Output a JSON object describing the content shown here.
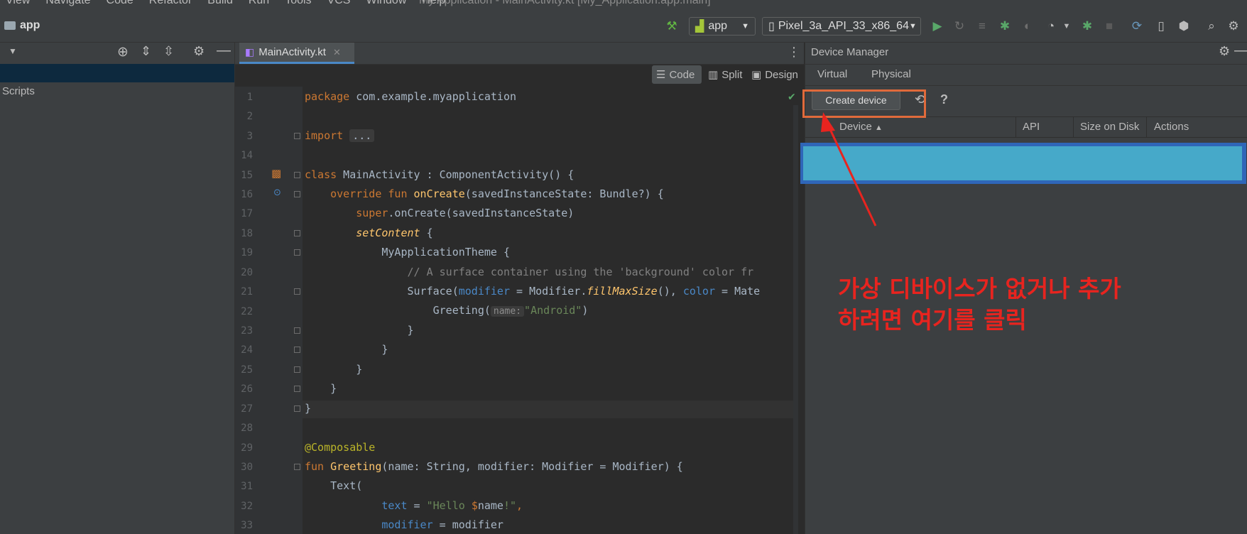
{
  "menubar": {
    "items": [
      "View",
      "Navigate",
      "Code",
      "Refactor",
      "Build",
      "Run",
      "Tools",
      "VCS",
      "Window",
      "Help"
    ],
    "window_title": "My Application - MainActivity.kt [My_Application.app.main]"
  },
  "toolbar": {
    "project": "app",
    "run_config": "app",
    "device": "Pixel_3a_API_33_x86_64"
  },
  "left_panel": {
    "item": "Scripts"
  },
  "editor": {
    "tab_label": "MainActivity.kt",
    "view_modes": [
      "Code",
      "Split",
      "Design"
    ],
    "param_hint": "name:",
    "line_numbers": [
      "1",
      "2",
      "3",
      "14",
      "15",
      "16",
      "17",
      "18",
      "19",
      "20",
      "21",
      "22",
      "23",
      "24",
      "25",
      "26",
      "27",
      "28",
      "29",
      "30",
      "31",
      "32",
      "33"
    ],
    "code": {
      "l1_kw": "package",
      "l1_rest": " com.example.myapplication",
      "l3_kw": "import",
      "l3_rest": "...",
      "l15_kw": "class",
      "l15_rest": " MainActivity : ComponentActivity() {",
      "l16_kw": "    override fun ",
      "l16_fn": "onCreate",
      "l16_rest": "(savedInstanceState: Bundle?) {",
      "l17_kw": "        super",
      "l17_rest": ".onCreate(savedInstanceState)",
      "l18_fn": "        setContent",
      "l18_rest": " {",
      "l19_fn": "            MyApplicationTheme",
      "l19_rest": " {",
      "l20_cm": "                // A surface container using the 'background' color fr",
      "l21_a": "                Surface(",
      "l21_b": "modifier",
      "l21_c": " = Modifier.",
      "l21_d": "fillMaxSize",
      "l21_e": "(), ",
      "l21_f": "color",
      "l21_g": " = Mate",
      "l22_a": "                    Greeting(",
      "l22_str": "\"Android\"",
      "l22_end": ")",
      "l23": "                }",
      "l24": "            }",
      "l25": "        }",
      "l26": "    }",
      "l27": "}",
      "l29_ann": "@Composable",
      "l30_kw": "fun ",
      "l30_fn": "Greeting",
      "l30_rest": "(name: String, modifier: Modifier = Modifier) {",
      "l31": "    Text(",
      "l32_a": "            ",
      "l32_b": "text",
      "l32_c": " = ",
      "l32_str1": "\"Hello ",
      "l32_d": "$",
      "l32_e": "name",
      "l32_str2": "!\"",
      "l32_f": ",",
      "l33_a": "            ",
      "l33_b": "modifier",
      "l33_c": " = modifier"
    }
  },
  "device_manager": {
    "title": "Device Manager",
    "tabs": [
      "Virtual",
      "Physical"
    ],
    "create_button": "Create device",
    "help": "?",
    "columns": [
      "Device",
      "API",
      "Size on Disk",
      "Actions"
    ],
    "sort_arrow": "▲"
  },
  "annotation": {
    "line1": "가상 디바이스가 없거나 추가",
    "line2": "하려면 여기를 클릭",
    "color": "#e8241f"
  }
}
